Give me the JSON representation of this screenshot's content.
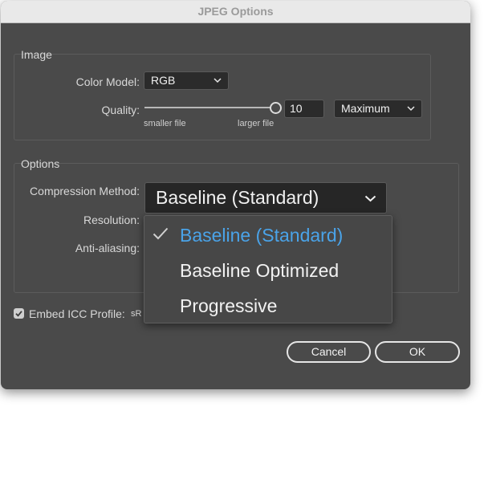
{
  "window": {
    "title": "JPEG Options"
  },
  "image_group": {
    "title": "Image",
    "color_model_label": "Color Model:",
    "color_model_value": "RGB",
    "quality_label": "Quality:",
    "slider_min_label": "smaller file",
    "slider_max_label": "larger file",
    "quality_value": "10",
    "quality_slider_fraction": 1.0,
    "quality_preset": "Maximum"
  },
  "options_group": {
    "title": "Options",
    "compression_label": "Compression Method:",
    "compression_value": "Baseline (Standard)",
    "resolution_label": "Resolution:",
    "antialiasing_label": "Anti-aliasing:"
  },
  "compression_menu": {
    "items": [
      {
        "label": "Baseline (Standard)",
        "selected": true
      },
      {
        "label": "Baseline Optimized",
        "selected": false
      },
      {
        "label": "Progressive",
        "selected": false
      }
    ]
  },
  "embed_icc": {
    "label": "Embed ICC Profile:",
    "checked": true,
    "profile_partial": "sR"
  },
  "buttons": {
    "cancel": "Cancel",
    "ok": "OK"
  },
  "colors": {
    "dialog_bg": "#4a4a4a",
    "selected_item": "#4aa3e8"
  }
}
